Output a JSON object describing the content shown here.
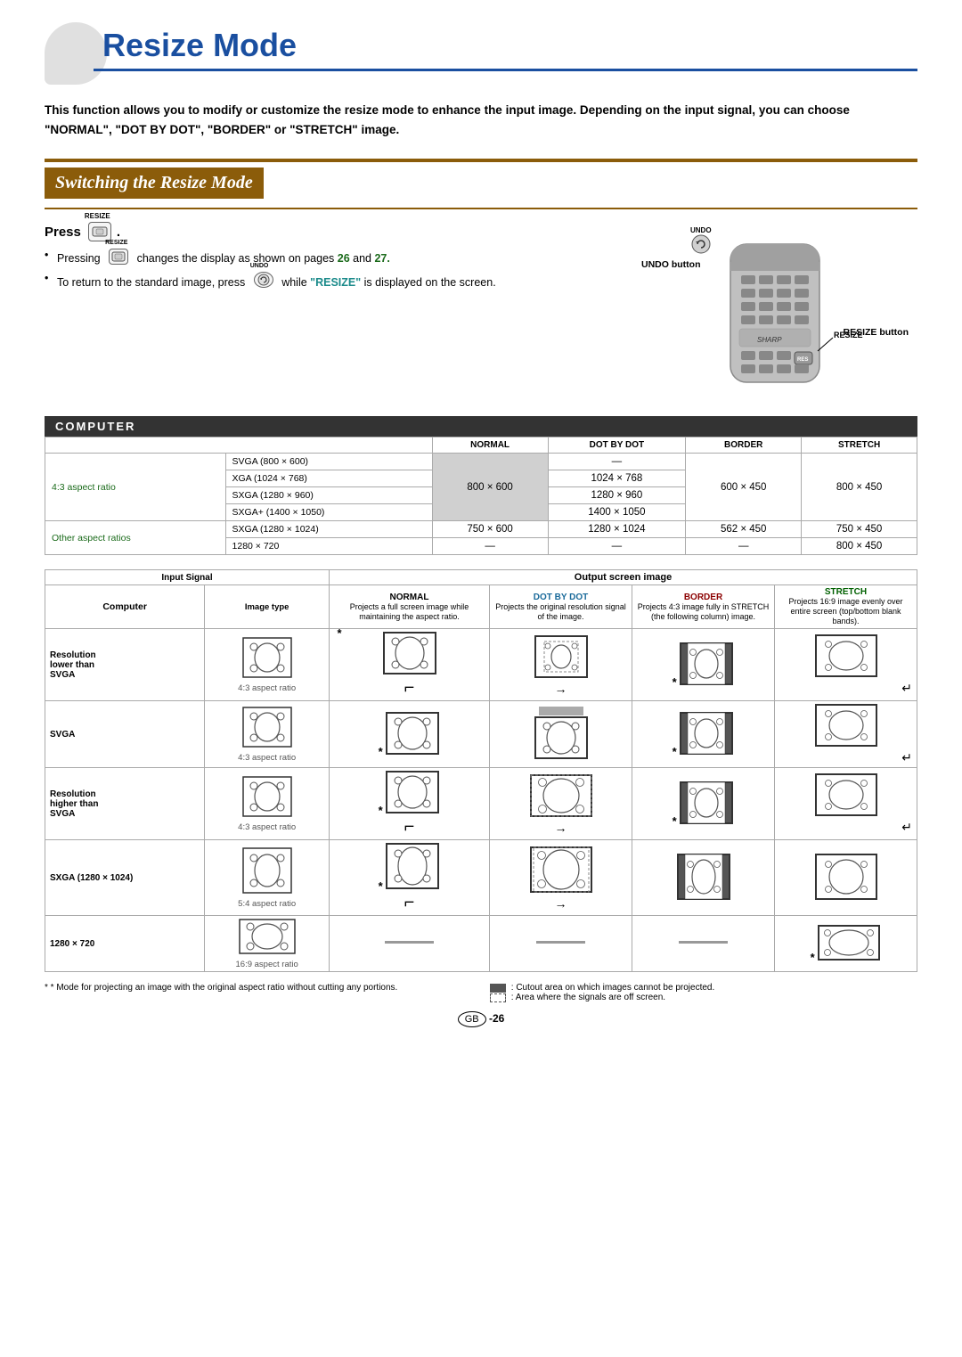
{
  "page": {
    "title": "Resize Mode",
    "intro": "This function allows you to modify or customize the resize mode to enhance the input image. Depending on the input signal, you can choose \"NORMAL\", \"DOT BY DOT\", \"BORDER\" or \"STRETCH\" image."
  },
  "section1": {
    "heading": "Switching the Resize Mode",
    "press_label": "Press",
    "bullet1_pre": "Pressing",
    "bullet1_post": "changes the display as shown on pages",
    "page26": "26",
    "and": "and",
    "page27": "27.",
    "bullet2_pre": "To return to the standard image, press",
    "bullet2_post": "while",
    "resize_word": "\"RESIZE\"",
    "bullet2_end": "is displayed on the screen.",
    "undo_label": "UNDO button",
    "resize_label": "RESIZE button"
  },
  "computer_section": {
    "header": "COMPUTER"
  },
  "top_table": {
    "col_normal": "NORMAL",
    "col_dotbydot": "DOT BY DOT",
    "col_border": "BORDER",
    "col_stretch": "STRETCH",
    "row1_label": "4:3 aspect ratio",
    "row1_sub1": "SVGA (800 × 600)",
    "row1_sub2": "XGA (1024 × 768)",
    "row1_sub3": "SXGA (1280 × 960)",
    "row1_sub4": "SXGA+ (1400 × 1050)",
    "row1_normal": "800 × 600",
    "row1_dotbydot1": "—",
    "row1_dotbydot2": "1024 × 768",
    "row1_dotbydot3": "1280 × 960",
    "row1_dotbydot4": "1400 × 1050",
    "row1_border": "600 × 450",
    "row1_stretch": "800 × 450",
    "row2_label": "Other aspect ratios",
    "row2_sub1": "SXGA (1280 × 1024)",
    "row2_sub2": "1280 × 720",
    "row2_normal1": "750 × 600",
    "row2_normal2": "—",
    "row2_dotbydot1": "1280 × 1024",
    "row2_dotbydot2": "—",
    "row2_border1": "562 × 450",
    "row2_border2": "—",
    "row2_stretch1": "750 × 450",
    "row2_stretch2": "800 × 450"
  },
  "detail_table": {
    "input_signal": "Input Signal",
    "output_screen": "Output screen image",
    "computer_col": "Computer",
    "image_type_col": "Image type",
    "normal_head": "NORMAL",
    "normal_desc": "Projects a full screen image while maintaining the aspect ratio.",
    "dotbydot_head": "DOT BY DOT",
    "dotbydot_desc": "Projects the original resolution signal of the image.",
    "border_head": "BORDER",
    "border_desc": "Projects 4:3 image fully in STRETCH (the following column) image.",
    "stretch_head": "STRETCH",
    "stretch_desc": "Projects 16:9 image evenly over entire screen (top/bottom blank bands).",
    "row1_computer": "Resolution\nlower than\nSVGA",
    "row1_aspect": "4:3 aspect ratio",
    "row2_computer": "SVGA",
    "row2_aspect": "4:3 aspect ratio",
    "row3_computer": "Resolution\nhigher than\nSVGA",
    "row3_aspect": "4:3 aspect ratio",
    "row4_computer": "SXGA (1280 × 1024)",
    "row4_aspect": "5:4 aspect ratio",
    "row5_computer": "1280 × 720",
    "row5_aspect": "16:9 aspect ratio"
  },
  "footnotes": {
    "asterisk_note": "* Mode for projecting an image with the original aspect ratio without cutting any portions.",
    "solid_legend": ": Cutout area on which images cannot be projected.",
    "dots_legend": ": Area where the signals are off screen."
  },
  "page_number": "GB -26"
}
